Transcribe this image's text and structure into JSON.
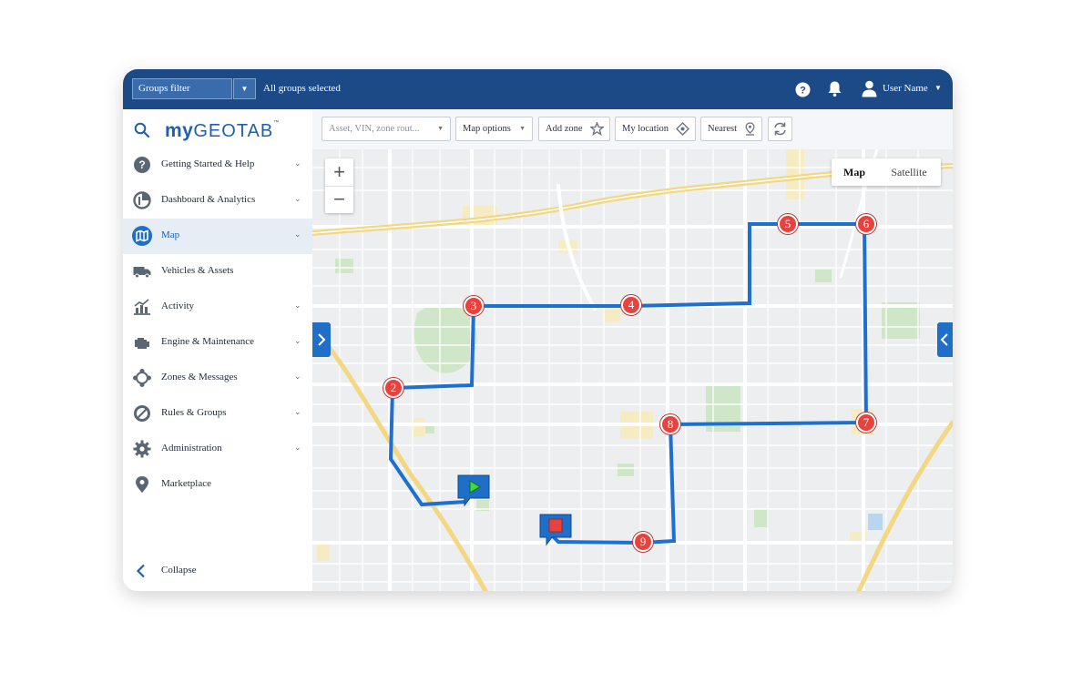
{
  "topbar": {
    "groups_filter_label": "Groups filter",
    "groups_status": "All groups selected",
    "user_name": "User Name"
  },
  "sidebar": {
    "logo_my": "my",
    "logo_geotab": "GEOTAB",
    "logo_tm": "™",
    "items": [
      {
        "label": "Getting Started & Help",
        "icon": "help-circle-icon",
        "has_chevron": true,
        "active": false
      },
      {
        "label": "Dashboard & Analytics",
        "icon": "dashboard-pie-icon",
        "has_chevron": true,
        "active": false
      },
      {
        "label": "Map",
        "icon": "map-icon",
        "has_chevron": true,
        "active": true
      },
      {
        "label": "Vehicles & Assets",
        "icon": "truck-icon",
        "has_chevron": false,
        "active": false
      },
      {
        "label": "Activity",
        "icon": "activity-chart-icon",
        "has_chevron": true,
        "active": false
      },
      {
        "label": "Engine & Maintenance",
        "icon": "engine-icon",
        "has_chevron": true,
        "active": false
      },
      {
        "label": "Zones & Messages",
        "icon": "zones-network-icon",
        "has_chevron": true,
        "active": false
      },
      {
        "label": "Rules & Groups",
        "icon": "rules-compass-icon",
        "has_chevron": true,
        "active": false
      },
      {
        "label": "Administration",
        "icon": "gear-icon",
        "has_chevron": true,
        "active": false
      },
      {
        "label": "Marketplace",
        "icon": "marketplace-pin-icon",
        "has_chevron": false,
        "active": false
      }
    ],
    "collapse_label": "Collapse"
  },
  "toolbar": {
    "search_placeholder": "Asset, VIN, zone rout...",
    "map_options": "Map options",
    "add_zone": "Add zone",
    "my_location": "My location",
    "nearest": "Nearest"
  },
  "map": {
    "zoom_in": "+",
    "zoom_out": "−",
    "type_map": "Map",
    "type_satellite": "Satellite",
    "route_color": "#1f6fd0",
    "stop_color": "#e8423e",
    "stops": [
      "2",
      "3",
      "4",
      "5",
      "6",
      "7",
      "8",
      "9"
    ]
  }
}
